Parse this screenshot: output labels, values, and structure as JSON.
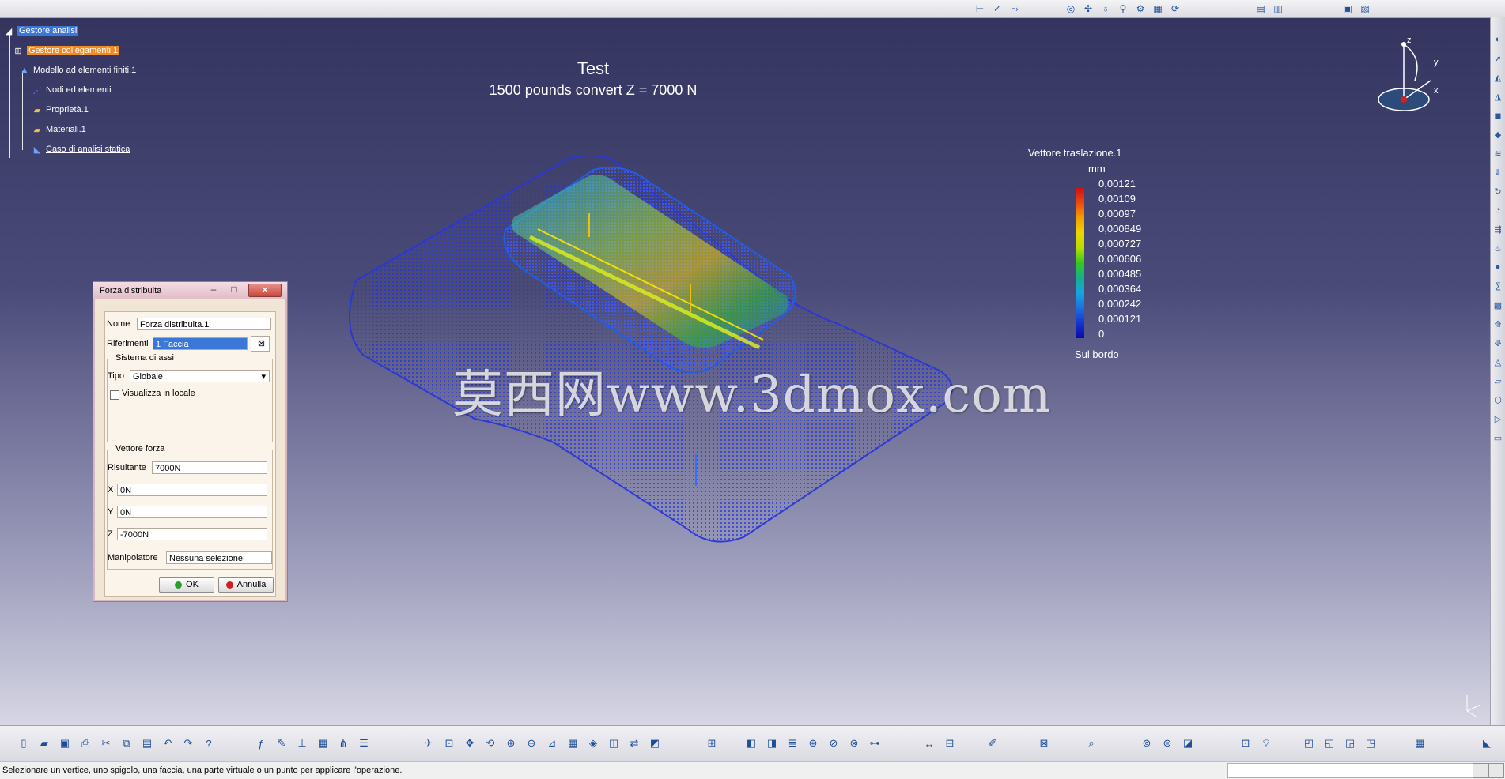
{
  "tree": {
    "root": "Gestore analisi",
    "items": [
      "Gestore collegamenti.1",
      "Modello ad elementi finiti.1",
      "Nodi ed elementi",
      "Proprietà.1",
      "Materiali.1",
      "Caso di analisi statica"
    ]
  },
  "plot": {
    "title": "Test",
    "subtitle": "1500 pounds convert Z = 7000 N"
  },
  "legend": {
    "title": "Vettore traslazione.1",
    "unit": "mm",
    "values": [
      "0,00121",
      "0,00109",
      "0,00097",
      "0,000849",
      "0,000727",
      "0,000606",
      "0,000485",
      "0,000364",
      "0,000242",
      "0,000121",
      "0"
    ],
    "footer": "Sul bordo",
    "colors": [
      "#d01010",
      "#f5a000",
      "#ecd600",
      "#34c81e",
      "#16a6e0",
      "#0a0aa8"
    ]
  },
  "watermark": "莫西网www.3dmox.com",
  "compass": {
    "z": "z",
    "y": "y",
    "x": "x"
  },
  "dialog": {
    "title": "Forza distribuita",
    "name_label": "Nome",
    "name_value": "Forza distribuita.1",
    "ref_label": "Riferimenti",
    "ref_value": "1 Faccia",
    "axes_group": "Sistema di assi",
    "type_label": "Tipo",
    "type_value": "Globale",
    "local_label": "Visualizza in locale",
    "force_group": "Vettore forza",
    "result_label": "Risultante",
    "result_value": "7000N",
    "x_label": "X",
    "x_value": "0N",
    "y_label": "Y",
    "y_value": "0N",
    "z_label": "Z",
    "z_value": "-7000N",
    "manip_label": "Manipolatore",
    "manip_value": "Nessuna selezione",
    "ok_label": "OK",
    "cancel_label": "Annulla"
  },
  "status": {
    "text": "Selezionare un vertice, uno spigolo, una faccia, una parte virtuale o un punto per applicare l'operazione."
  },
  "accent_colors": {
    "background_top": "#33335e",
    "mesh": "#1a28d8",
    "dialog_bg": "#f1e6d5",
    "selection": "#3a78d8"
  }
}
